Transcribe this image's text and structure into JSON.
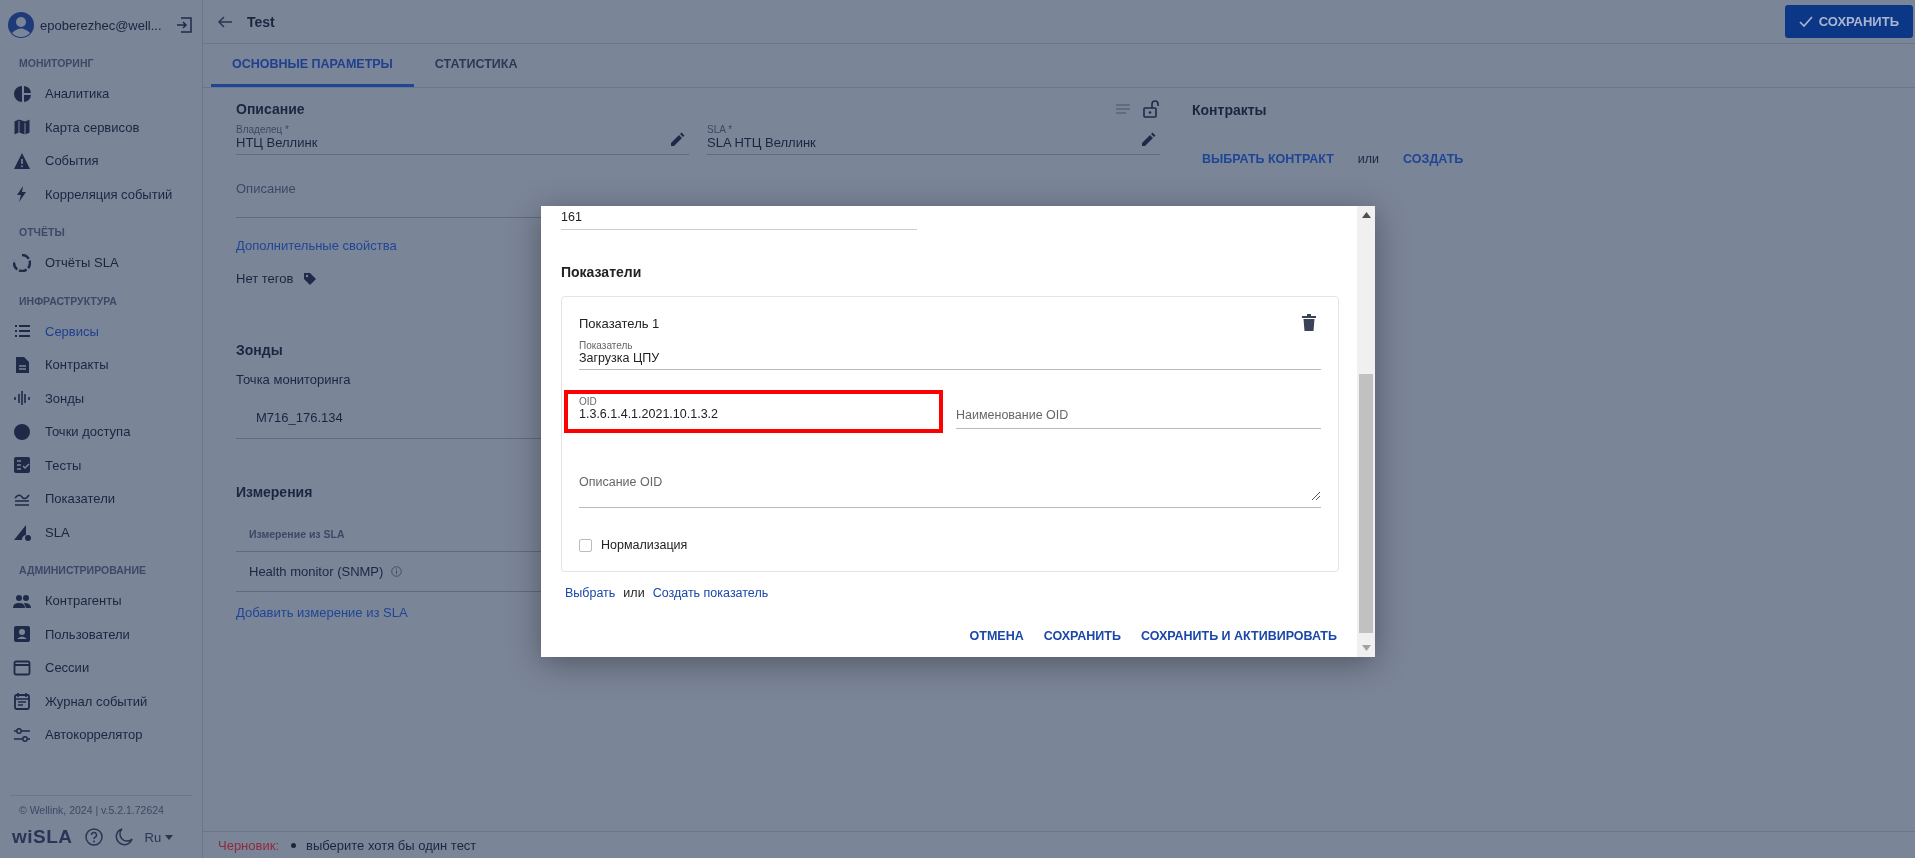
{
  "user": {
    "email": "epoberezhec@well..."
  },
  "sidebar": {
    "sections": [
      {
        "title": "МОНИТОРИНГ",
        "items": [
          {
            "label": "Аналитика",
            "selected": false
          },
          {
            "label": "Карта сервисов",
            "selected": false
          },
          {
            "label": "События",
            "selected": false
          },
          {
            "label": "Корреляция событий",
            "selected": false
          }
        ]
      },
      {
        "title": "ОТЧЁТЫ",
        "items": [
          {
            "label": "Отчёты SLA",
            "selected": false
          }
        ]
      },
      {
        "title": "ИНФРАСТРУКТУРА",
        "items": [
          {
            "label": "Сервисы",
            "selected": true
          },
          {
            "label": "Контракты",
            "selected": false
          },
          {
            "label": "Зонды",
            "selected": false
          },
          {
            "label": "Точки доступа",
            "selected": false
          },
          {
            "label": "Тесты",
            "selected": false
          },
          {
            "label": "Показатели",
            "selected": false
          },
          {
            "label": "SLA",
            "selected": false
          }
        ]
      },
      {
        "title": "АДМИНИСТРИРОВАНИЕ",
        "items": [
          {
            "label": "Контрагенты",
            "selected": false
          },
          {
            "label": "Пользователи",
            "selected": false
          },
          {
            "label": "Сессии",
            "selected": false
          },
          {
            "label": "Журнал событий",
            "selected": false
          },
          {
            "label": "Автокоррелятор",
            "selected": false
          }
        ]
      }
    ]
  },
  "footer": {
    "copyright": "© Wellink, 2024 | v.5.2.1.72624",
    "logo": "wiSLA",
    "language": "Ru"
  },
  "header": {
    "title": "Test",
    "save_button": "СОХРАНИТЬ"
  },
  "tabs": [
    {
      "label": "ОСНОВНЫЕ ПАРАМЕТРЫ",
      "selected": true
    },
    {
      "label": "СТАТИСТИКА",
      "selected": false
    }
  ],
  "description": {
    "heading": "Описание",
    "fields": [
      {
        "label": "Владелец *",
        "value": "НТЦ Веллинк"
      },
      {
        "label": "SLA *",
        "value": "SLA НТЦ Веллинк"
      }
    ],
    "description_placeholder": "Описание",
    "extra_link": "Дополнительные свойства",
    "tags": "Нет тегов"
  },
  "probes": {
    "heading": "Зонды",
    "label": "Точка мониторинга",
    "value": "M716_176.134"
  },
  "measurements": {
    "heading": "Измерения",
    "column": "Измерение из SLA",
    "rows": [
      "Health monitor (SNMP)"
    ],
    "add_link": "Добавить измерение из SLA"
  },
  "contracts": {
    "heading": "Контракты",
    "select": "ВЫБРАТЬ КОНТРАКТ",
    "or": "или",
    "create": "СОЗДАТЬ"
  },
  "status_bar": {
    "label": "Черновик:",
    "messages": [
      "выберите хотя бы один тест"
    ]
  },
  "dialog": {
    "top_field_value": "161",
    "heading": "Показатели",
    "indicators": [
      {
        "title": "Показатель 1",
        "indicator_label": "Показатель",
        "indicator_value": "Загрузка ЦПУ",
        "oid_label": "OID",
        "oid_value": "1.3.6.1.4.1.2021.10.1.3.2",
        "oid_highlighted": true,
        "oid_name_placeholder": "Наименование OID",
        "oid_description_placeholder": "Описание OID",
        "normalization": {
          "label": "Нормализация",
          "checked": false
        }
      }
    ],
    "select_link": "Выбрать",
    "or": "или",
    "create_link": "Создать показатель",
    "buttons": [
      "ОТМЕНА",
      "СОХРАНИТЬ",
      "СОХРАНИТЬ И АКТИВИРОВАТЬ"
    ]
  }
}
